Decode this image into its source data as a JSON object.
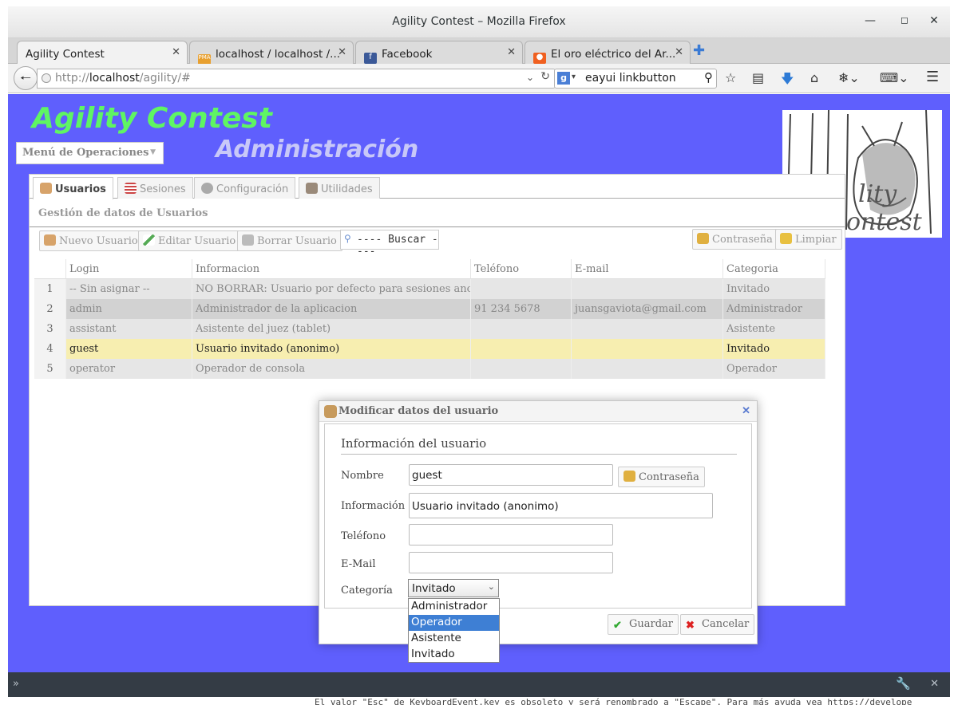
{
  "window": {
    "title": "Agility Contest – Mozilla Firefox"
  },
  "browser_tabs": [
    {
      "label": "Agility Contest"
    },
    {
      "label": "localhost / localhost /..."
    },
    {
      "label": "Facebook"
    },
    {
      "label": "El oro eléctrico del Ar..."
    }
  ],
  "address": {
    "prefix": "http://",
    "host": "localhost",
    "path": "/agility/#"
  },
  "search": {
    "value": "eayui linkbutton",
    "engine_icon": "google-icon"
  },
  "app": {
    "title": "Agility Contest",
    "section_title": "Administración",
    "menu_button": "Menú de Operaciones"
  },
  "panel_tabs": [
    {
      "label": "Usuarios",
      "icon": "users-icon"
    },
    {
      "label": "Sesiones",
      "icon": "list-icon"
    },
    {
      "label": "Configuración",
      "icon": "gear-icon"
    },
    {
      "label": "Utilidades",
      "icon": "tools-icon"
    }
  ],
  "panel": {
    "subtitle": "Gestión de datos de Usuarios"
  },
  "toolbar": {
    "new_user": "Nuevo Usuario",
    "edit_user": "Editar Usuario",
    "delete_user": "Borrar Usuario",
    "search": "---- Buscar ----",
    "password": "Contraseña",
    "clear": "Limpiar"
  },
  "table": {
    "columns": [
      "Login",
      "Informacion",
      "Teléfono",
      "E-mail",
      "Categoria"
    ],
    "rows": [
      {
        "n": "1",
        "login": "-- Sin asignar --",
        "info": "NO BORRAR: Usuario por defecto para sesiones anonim",
        "phone": "",
        "email": "",
        "category": "Invitado"
      },
      {
        "n": "2",
        "login": "admin",
        "info": "Administrador de la aplicacion",
        "phone": "91 234 5678",
        "email": "juansgaviota@gmail.com",
        "category": "Administrador"
      },
      {
        "n": "3",
        "login": "assistant",
        "info": "Asistente del juez (tablet)",
        "phone": "",
        "email": "",
        "category": "Asistente"
      },
      {
        "n": "4",
        "login": "guest",
        "info": "Usuario invitado (anonimo)",
        "phone": "",
        "email": "",
        "category": "Invitado"
      },
      {
        "n": "5",
        "login": "operator",
        "info": "Operador de consola",
        "phone": "",
        "email": "",
        "category": "Operador"
      }
    ]
  },
  "dialog": {
    "title": "Modificar datos del usuario",
    "section": "Información del usuario",
    "labels": {
      "name": "Nombre",
      "info": "Información",
      "phone": "Teléfono",
      "email": "E-Mail",
      "category": "Categoría"
    },
    "values": {
      "name": "guest",
      "info": "Usuario invitado (anonimo)",
      "phone": "",
      "email": "",
      "category": "Invitado"
    },
    "password_button": "Contraseña",
    "save": "Guardar",
    "cancel": "Cancelar"
  },
  "category_options": [
    "Administrador",
    "Operador",
    "Asistente",
    "Invitado"
  ],
  "console_message": "El valor \"Esc\" de KeyboardEvent.key es obsoleto y será renombrado a \"Escape\". Para más ayuda vea https://develope",
  "colors": {
    "page_bg": "#5f5ffd",
    "title_green": "#5ff563",
    "highlight_row": "#f7eeb0",
    "selected_option": "#3e7fd4"
  }
}
